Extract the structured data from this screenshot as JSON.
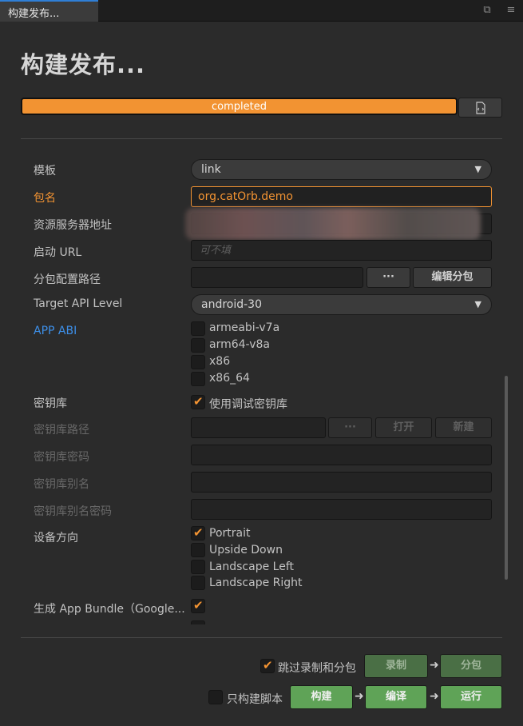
{
  "tab": {
    "title": "构建发布..."
  },
  "header": {
    "title": "构建发布..."
  },
  "progress": {
    "text": "completed",
    "value": 1.0
  },
  "form": {
    "template": {
      "label": "模板",
      "value": "link"
    },
    "package": {
      "label": "包名",
      "value": "org.catOrb.demo"
    },
    "server": {
      "label": "资源服务器地址"
    },
    "start_url": {
      "label": "启动 URL",
      "placeholder": "可不填"
    },
    "subpackage": {
      "label": "分包配置路径",
      "browse": "···",
      "edit": "编辑分包"
    },
    "api": {
      "label": "Target API Level",
      "value": "android-30"
    },
    "abi": {
      "label": "APP ABI",
      "options": [
        "armeabi-v7a",
        "arm64-v8a",
        "x86",
        "x86_64"
      ]
    },
    "keystore": {
      "label": "密钥库",
      "use_debug": "使用调试密钥库"
    },
    "keystore_path": {
      "label": "密钥库路径",
      "browse": "···",
      "open": "打开",
      "new": "新建"
    },
    "keystore_password": {
      "label": "密钥库密码"
    },
    "keystore_alias": {
      "label": "密钥库别名"
    },
    "keystore_alias_password": {
      "label": "密钥库别名密码"
    },
    "orientation": {
      "label": "设备方向",
      "options": [
        "Portrait",
        "Upside Down",
        "Landscape Left",
        "Landscape Right"
      ]
    },
    "app_bundle": {
      "label": "生成 App Bundle（Google..."
    }
  },
  "footer": {
    "skip_label": "跳过录制和分包",
    "record": "录制",
    "subpackage": "分包",
    "only_script": "只构建脚本",
    "build": "构建",
    "compile": "编译",
    "run": "运行"
  },
  "colors": {
    "accent": "#f29332",
    "link": "#3d8fe8",
    "green": "#5fa357"
  }
}
